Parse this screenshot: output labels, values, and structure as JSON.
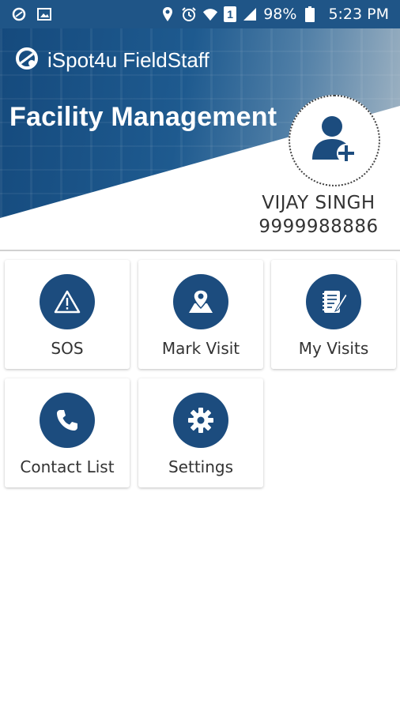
{
  "status_bar": {
    "left_icons": [
      "ispot-notification-icon",
      "image-notification-icon"
    ],
    "right_icons": [
      "location-icon",
      "alarm-icon",
      "wifi-icon",
      "sim-icon",
      "signal-icon",
      "battery-icon"
    ],
    "sim_label": "1",
    "battery": "98%",
    "time": "5:23 PM"
  },
  "header": {
    "app_name": "iSpot4u FieldStaff",
    "title": "Facility Management"
  },
  "profile": {
    "name": "VIJAY SINGH",
    "phone": "9999988886"
  },
  "menu": {
    "items": [
      {
        "label": "SOS",
        "icon": "warning-icon"
      },
      {
        "label": "Mark Visit",
        "icon": "map-pin-icon"
      },
      {
        "label": "My Visits",
        "icon": "notebook-icon"
      },
      {
        "label": "Contact List",
        "icon": "phone-icon"
      },
      {
        "label": "Settings",
        "icon": "gear-icon"
      }
    ]
  },
  "colors": {
    "primary": "#1c4c7e",
    "status_bar": "#1f5587",
    "text": "#333333"
  }
}
